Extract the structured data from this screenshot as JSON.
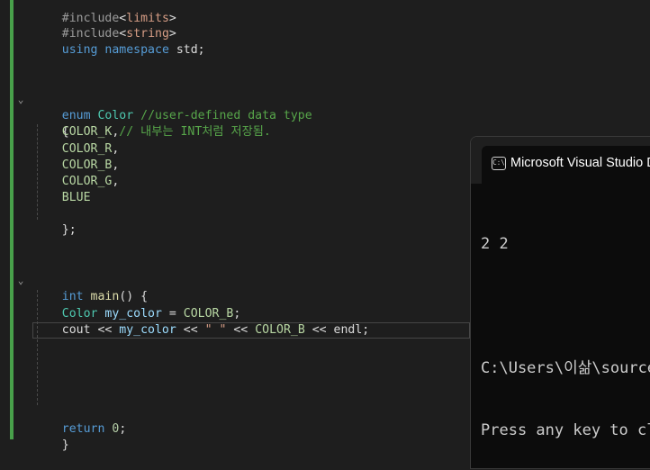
{
  "editor": {
    "includes": [
      {
        "directive": "#include",
        "open": "<",
        "header": "limits",
        "close": ">"
      },
      {
        "directive": "#include",
        "open": "<",
        "header": "string",
        "close": ">"
      }
    ],
    "using_line": {
      "kw1": "using",
      "kw2": "namespace",
      "rest": " std;"
    },
    "enum_decl": {
      "kw": "enum",
      "name": "Color",
      "comment": "//user-defined data type"
    },
    "open_brace": "{",
    "enumerators": [
      {
        "name": "COLOR_K",
        "punct": ",",
        "comment": "// 내부는 INT처럼 저장됨."
      },
      {
        "name": "COLOR_R",
        "punct": ",",
        "comment": ""
      },
      {
        "name": "COLOR_B",
        "punct": ",",
        "comment": ""
      },
      {
        "name": "COLOR_G",
        "punct": ",",
        "comment": ""
      },
      {
        "name": "BLUE",
        "punct": "",
        "comment": ""
      }
    ],
    "close_brace_semi": "};",
    "main_decl": {
      "kw": "int",
      "name": "main",
      "rest": "() {"
    },
    "decl_line": {
      "type": "Color",
      "var": "my_color",
      "op": " = ",
      "value": "COLOR_B",
      "end": ";"
    },
    "cout_line": {
      "cout": "cout",
      "op1": " << ",
      "var": "my_color",
      "op2": " << ",
      "str": "\" \"",
      "op3": " << ",
      "value": "COLOR_B",
      "op4": " << ",
      "endl": "endl",
      "end": ";"
    },
    "return_line": {
      "kw": "return",
      "num": "0",
      "end": ";"
    },
    "close_brace": "}",
    "fold_glyph": "⌄"
  },
  "console": {
    "title": "Microsoft Visual Studio Debug Console",
    "icon_text": "C:\\",
    "output_lines": [
      "2 2",
      "",
      "C:\\Users\\이삶\\source\\repos",
      "Press any key to close this window . . ."
    ]
  }
}
